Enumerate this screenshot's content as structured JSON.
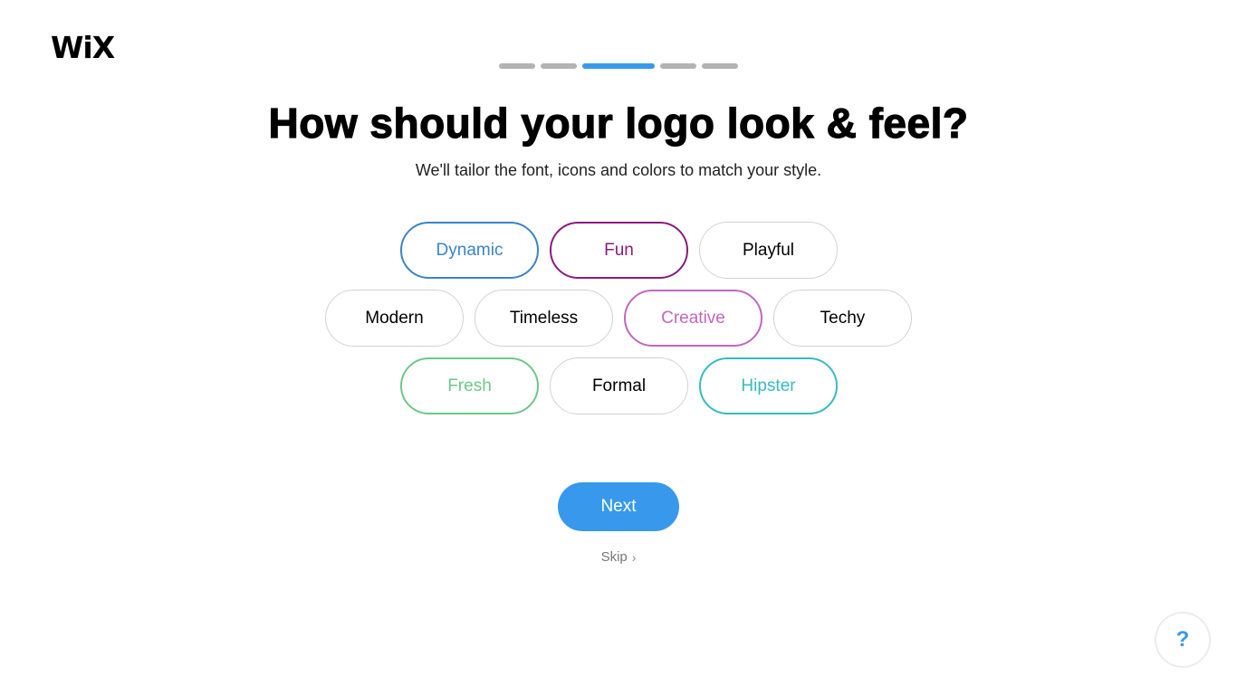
{
  "brand": {
    "logo_text": "WiX"
  },
  "progress": {
    "total_steps": 5,
    "current_step": 3
  },
  "header": {
    "title": "How should your logo look & feel?",
    "subtitle": "We'll tailor the font, icons and colors to match your style."
  },
  "styles": [
    {
      "label": "Dynamic",
      "selected": true,
      "color": "#3a84c9"
    },
    {
      "label": "Fun",
      "selected": true,
      "color": "#8a1b7f"
    },
    {
      "label": "Playful",
      "selected": false,
      "color": "#000000"
    },
    {
      "label": "Modern",
      "selected": false,
      "color": "#000000"
    },
    {
      "label": "Timeless",
      "selected": false,
      "color": "#000000"
    },
    {
      "label": "Creative",
      "selected": true,
      "color": "#c267bd"
    },
    {
      "label": "Techy",
      "selected": false,
      "color": "#000000"
    },
    {
      "label": "Fresh",
      "selected": true,
      "color": "#6cc88b"
    },
    {
      "label": "Formal",
      "selected": false,
      "color": "#000000"
    },
    {
      "label": "Hipster",
      "selected": true,
      "color": "#35bcc1"
    }
  ],
  "actions": {
    "next_label": "Next",
    "skip_label": "Skip",
    "skip_icon": "chevron-right-icon"
  },
  "help": {
    "label": "?",
    "icon": "help-icon"
  },
  "colors": {
    "accent": "#3899ec",
    "inactive_step": "#b3b3b3",
    "chip_border": "#d2d2d2"
  }
}
